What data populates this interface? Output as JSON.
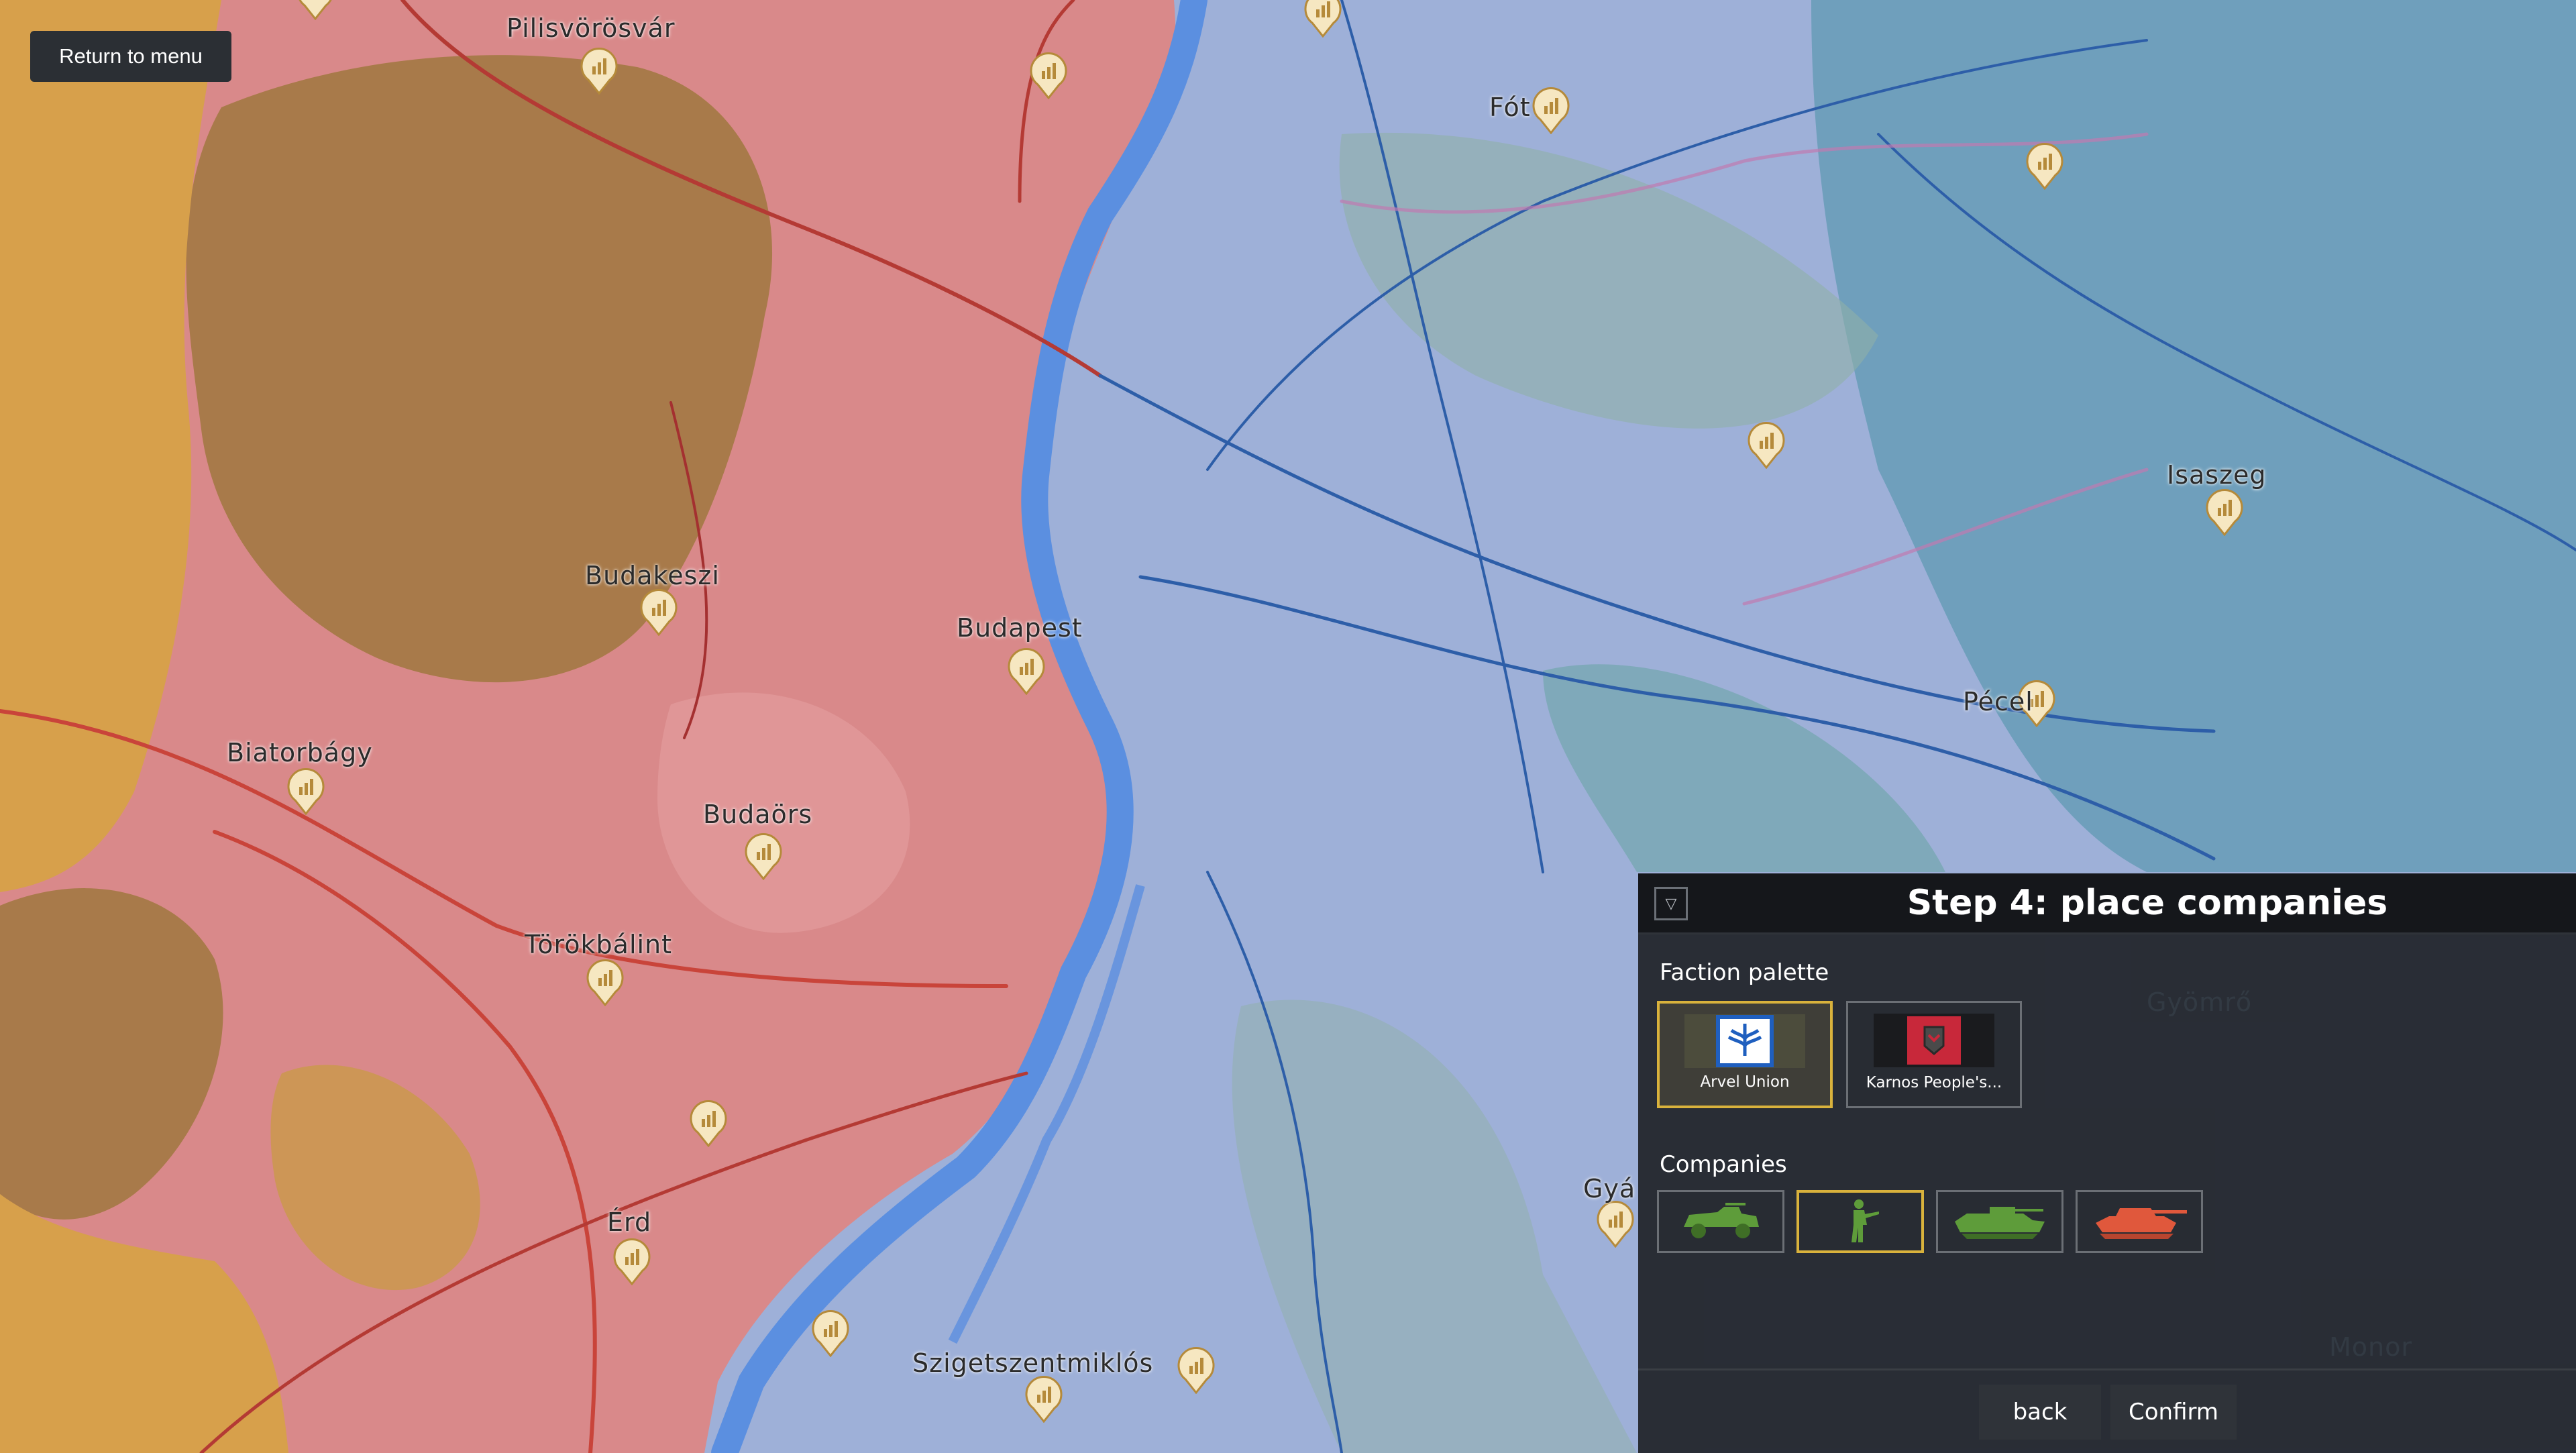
{
  "ui": {
    "return_to_menu_label": "Return to menu"
  },
  "cities": [
    {
      "name": "Pilisvörösvár"
    },
    {
      "name": "Fót"
    },
    {
      "name": "Budakeszi"
    },
    {
      "name": "Budapest"
    },
    {
      "name": "Biatorbágy"
    },
    {
      "name": "Budaörs"
    },
    {
      "name": "Törökbálint"
    },
    {
      "name": "Érd"
    },
    {
      "name": "Szigetszentmiklós"
    },
    {
      "name": "Isaszeg"
    },
    {
      "name": "Pécel"
    },
    {
      "name": "Gyömrő"
    },
    {
      "name": "Monor"
    },
    {
      "name": "Gyá"
    }
  ],
  "panel": {
    "title": "Step 4: place companies",
    "collapse_icon": "▽",
    "faction_palette_label": "Faction palette",
    "factions": [
      {
        "name": "Arvel Union",
        "selected": true,
        "flag_color": "#1f5fbf"
      },
      {
        "name": "Karnos People's...",
        "selected": false,
        "flag_color": "#c8283a"
      }
    ],
    "companies_label": "Companies",
    "companies": [
      {
        "icon": "armored-car-icon",
        "color": "#5e9c3a",
        "selected": false
      },
      {
        "icon": "infantry-icon",
        "color": "#5e9c3a",
        "selected": true
      },
      {
        "icon": "ifv-icon",
        "color": "#5e9c3a",
        "selected": false
      },
      {
        "icon": "tank-icon",
        "color": "#e0583c",
        "selected": false
      }
    ],
    "back_label": "back",
    "confirm_label": "Confirm"
  },
  "colors": {
    "west_faction": "#d9898a",
    "east_faction": "#9eb0d8",
    "river": "#5b8fe0",
    "selection": "#d9b23c"
  }
}
